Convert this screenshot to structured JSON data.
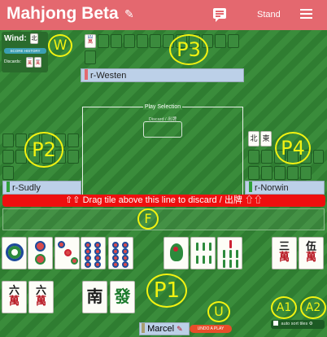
{
  "header": {
    "title": "Mahjong Beta",
    "stand_label": "Stand",
    "icons": [
      "paintbrush-icon",
      "chat-icon",
      "hamburger-menu-icon"
    ]
  },
  "wind_panel": {
    "wind_label": "Wind:",
    "wind_tile": "北",
    "score_history_label": "SCORE HISTORY",
    "discards_label": "Discards:",
    "discard_tiles": [
      "一萬",
      "二萬"
    ]
  },
  "play_area": {
    "title": "Play Selection",
    "discard_hint": "Discard / 出牌"
  },
  "players": {
    "p3_name": "r-Westen",
    "p2_name": "r-Sudly",
    "p4_name": "r-Norwin",
    "you_name": "Marcel"
  },
  "drag_bar_text": "⇧⇧ Drag tile above this line to discard / 出牌 ⇧⇧",
  "buttons": {
    "undo_label": "UNDO A PLAY",
    "auto_sort_label": "auto sort tiles"
  },
  "overlay_labels": {
    "w": "W",
    "p3": "P3",
    "p2": "P2",
    "p4": "P4",
    "f": "F",
    "p1": "P1",
    "u": "U",
    "a1": "A1",
    "a2": "A2"
  },
  "hand_tiles": {
    "row1": [
      "1筒",
      "2筒",
      "3筒",
      "8筒",
      "1索",
      "6索",
      "7索",
      "三萬",
      "五萬"
    ],
    "row2": [
      "六萬",
      "六萬",
      "南",
      "發"
    ]
  },
  "exposed_tiles": {
    "p3": [
      "四萬"
    ],
    "p4": [
      "北",
      "東"
    ]
  },
  "colors": {
    "header": "#e4686f",
    "table_dark": "#2f7d31",
    "table_light": "#3a8c3b",
    "drag_bar": "#ee0f0f",
    "label_yellow": "#f2f211"
  }
}
